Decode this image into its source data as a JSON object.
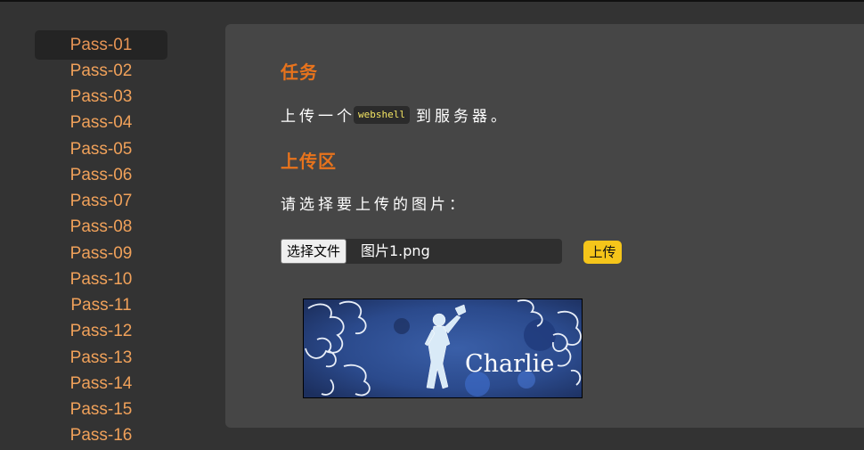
{
  "sidebar": {
    "items": [
      {
        "label": "Pass-01",
        "active": true
      },
      {
        "label": "Pass-02"
      },
      {
        "label": "Pass-03"
      },
      {
        "label": "Pass-04"
      },
      {
        "label": "Pass-05"
      },
      {
        "label": "Pass-06"
      },
      {
        "label": "Pass-07"
      },
      {
        "label": "Pass-08"
      },
      {
        "label": "Pass-09"
      },
      {
        "label": "Pass-10"
      },
      {
        "label": "Pass-11"
      },
      {
        "label": "Pass-12"
      },
      {
        "label": "Pass-13"
      },
      {
        "label": "Pass-14"
      },
      {
        "label": "Pass-15"
      },
      {
        "label": "Pass-16"
      }
    ]
  },
  "task": {
    "heading": "任务",
    "text_before": "上传一个",
    "code": "webshell",
    "text_after": "到服务器。"
  },
  "upload": {
    "heading": "上传区",
    "prompt": "请选择要上传的图片：",
    "file_button_label": "选择文件",
    "file_name": "图片1.png",
    "submit_label": "上传"
  },
  "preview": {
    "caption": "Charlie"
  },
  "colors": {
    "heading": "#e8731c",
    "nav_text": "#f0a15a",
    "upload_button": "#f5c51a",
    "code_text": "#f5e663"
  }
}
